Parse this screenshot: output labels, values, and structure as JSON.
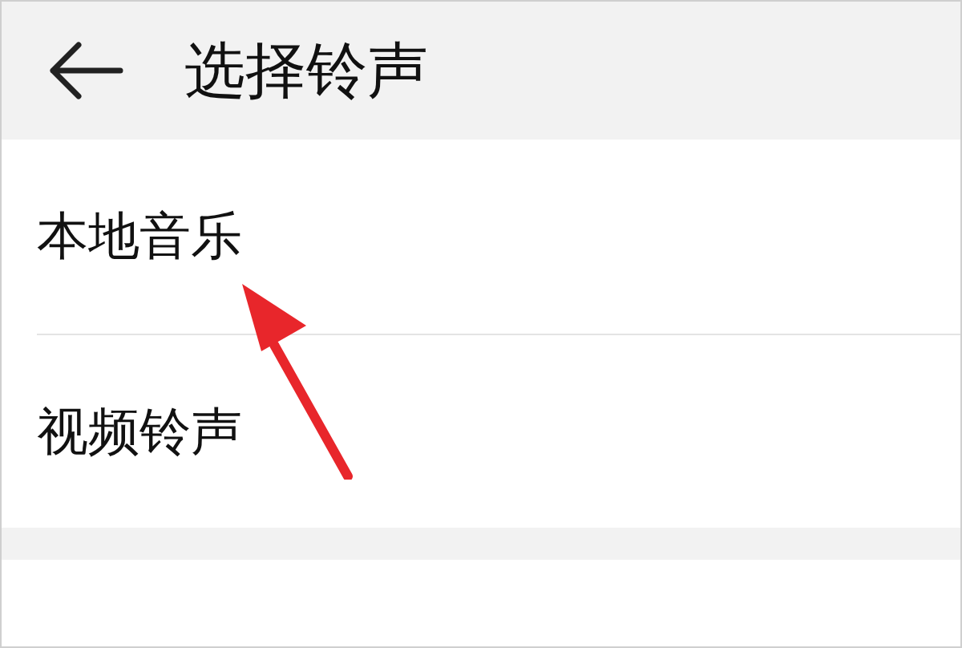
{
  "header": {
    "title": "选择铃声"
  },
  "items": [
    {
      "label": "本地音乐"
    },
    {
      "label": "视频铃声"
    }
  ]
}
